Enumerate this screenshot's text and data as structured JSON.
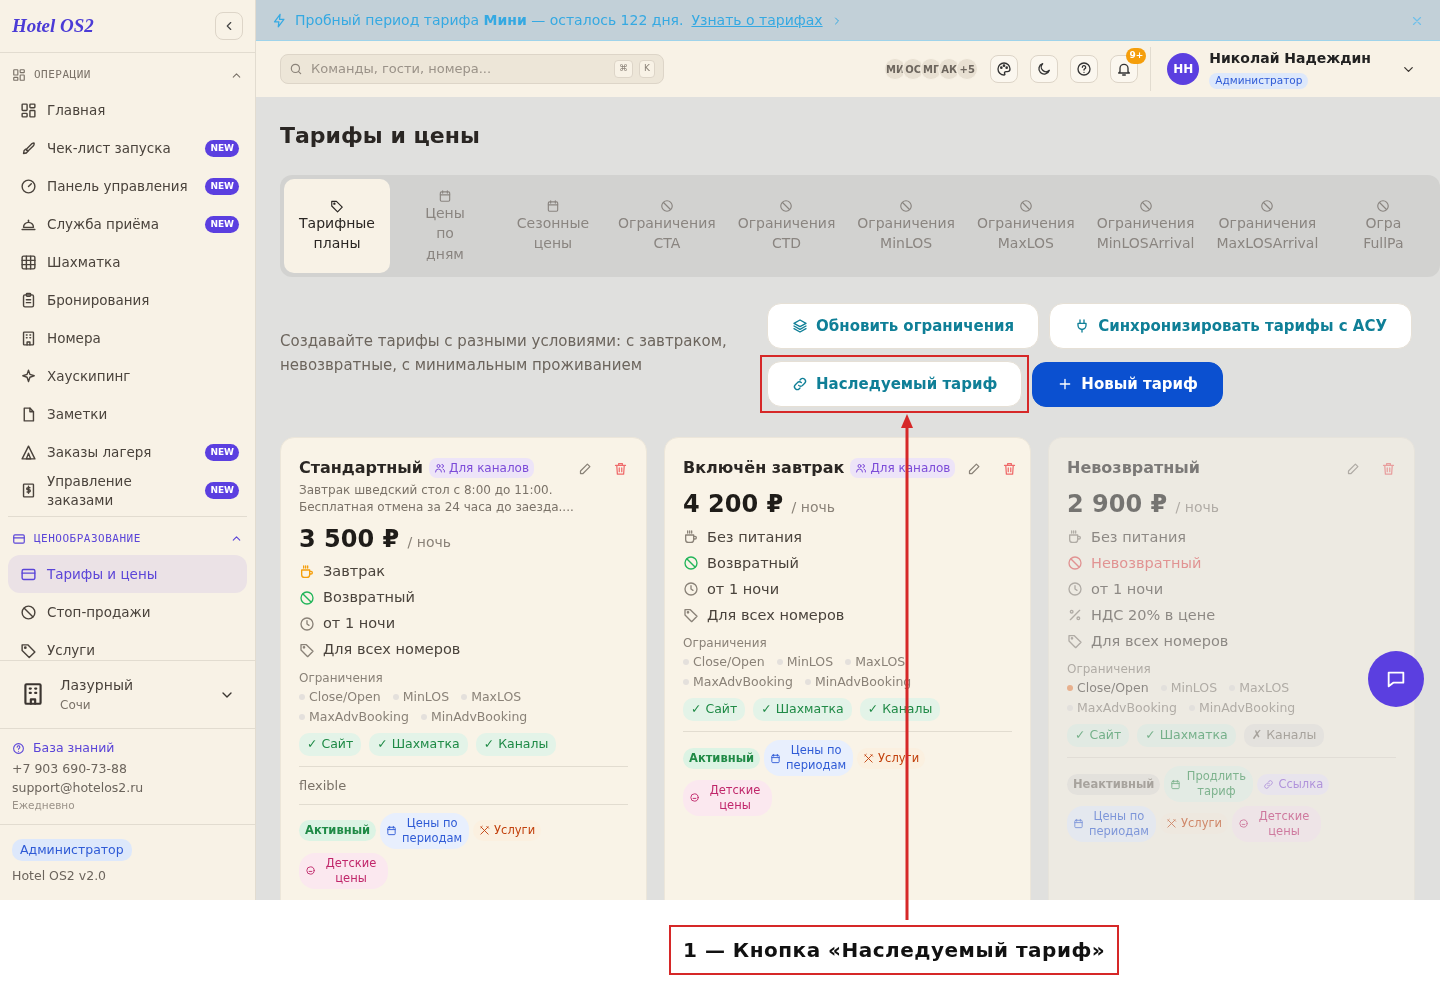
{
  "sidebar": {
    "logo": "Hotel OS2",
    "sections": [
      {
        "title": "ОПЕРАЦИИ",
        "expanded": true,
        "items": [
          {
            "label": "Главная",
            "selected": false
          },
          {
            "label": "Чек-лист запуска",
            "badge": "NEW",
            "selected": false
          },
          {
            "label": "Панель управления",
            "badge": "NEW",
            "selected": false
          },
          {
            "label": "Служба приёма",
            "badge": "NEW",
            "selected": false
          },
          {
            "label": "Шахматка",
            "selected": false
          },
          {
            "label": "Бронирования",
            "selected": false
          },
          {
            "label": "Номера",
            "selected": false
          },
          {
            "label": "Хаускипинг",
            "selected": false
          },
          {
            "label": "Заметки",
            "selected": false
          },
          {
            "label": "Заказы лагеря",
            "badge": "NEW",
            "selected": false
          },
          {
            "label": "Управление заказами",
            "badge": "NEW",
            "selected": false
          }
        ]
      },
      {
        "title": "ЦЕНООБРАЗОВАНИЕ",
        "expanded": true,
        "items": [
          {
            "label": "Тарифы и цены",
            "selected": true
          },
          {
            "label": "Стоп-продажи",
            "selected": false
          },
          {
            "label": "Услуги",
            "selected": false
          }
        ]
      }
    ],
    "property": {
      "name": "Лазурный",
      "city": "Сочи"
    },
    "help": {
      "link": "База знаний",
      "phone": "+7 903 690-73-88",
      "email": "support@hotelos2.ru",
      "hours": "Ежедневно"
    },
    "footer": {
      "role": "Администратор",
      "version": "Hotel OS2 v2.0"
    }
  },
  "banner": {
    "text": "Пробный период тарифа **Мини** — осталось 122 дня.",
    "link": "Узнать о тарифах"
  },
  "topbar": {
    "search": {
      "placeholder": "Команды, гости, номера..."
    },
    "shortcut": [
      "⌘",
      "K"
    ],
    "online_users": [
      "МИ",
      "ОС",
      "МГ",
      "АК"
    ],
    "more_users": "+5",
    "notifications": "9+",
    "user": {
      "initials": "НН",
      "name": "Николай Надеждин",
      "role": "Администратор"
    }
  },
  "page": {
    "title": "Тарифы и цены",
    "tabs": [
      {
        "kind": "plans",
        "lines": [
          "Тарифные",
          "планы"
        ],
        "selected": true
      },
      {
        "kind": "calendar",
        "lines": [
          "Цены",
          "по",
          "дням"
        ],
        "selected": false
      },
      {
        "kind": "calendar",
        "lines": [
          "Сезонные",
          "цены"
        ],
        "selected": false
      },
      {
        "kind": "restriction",
        "lines": [
          "Ограничения",
          "CTA"
        ],
        "selected": false
      },
      {
        "kind": "restriction",
        "lines": [
          "Ограничения",
          "CTD"
        ],
        "selected": false
      },
      {
        "kind": "restriction",
        "lines": [
          "Ограничения",
          "MinLOS"
        ],
        "selected": false
      },
      {
        "kind": "restriction",
        "lines": [
          "Ограничения",
          "MaxLOS"
        ],
        "selected": false
      },
      {
        "kind": "restriction",
        "lines": [
          "Ограничения",
          "MinLOSArrival"
        ],
        "selected": false
      },
      {
        "kind": "restriction",
        "lines": [
          "Ограничения",
          "MaxLOSArrival"
        ],
        "selected": false
      },
      {
        "kind": "restriction",
        "lines": [
          "Огра",
          "FullPa"
        ],
        "selected": false
      }
    ],
    "description": "Создавайте тарифы с разными условиями: с завтраком, невозвратные, с минимальным проживанием",
    "buttons": {
      "refresh": "Обновить ограничения",
      "sync": "Синхронизировать тарифы с АСУ",
      "inherited": "Наследуемый тариф",
      "new": "Новый тариф"
    }
  },
  "cards": [
    {
      "title": "Стандартный",
      "badge": "Для каналов",
      "description": "Завтрак шведский стол с 8:00 до 11:00. Бесплатная отмена за 24 часа до заезда....",
      "price": "3 500 ₽",
      "unit": "/ ночь",
      "active": true,
      "features": [
        {
          "kind": "meal",
          "label": "Завтрак",
          "included": true
        },
        {
          "kind": "refund",
          "label": "Возвратный",
          "refundable": true
        },
        {
          "kind": "stay",
          "label": "от 1 ночи"
        },
        {
          "kind": "rooms",
          "label": "Для всех номеров"
        }
      ],
      "restrictions_label": "Ограничения",
      "restrictions": [
        {
          "label": "Close/Open",
          "on": false
        },
        {
          "label": "MinLOS",
          "on": false
        },
        {
          "label": "MaxLOS",
          "on": false
        },
        {
          "label": "MaxAdvBooking",
          "on": false
        },
        {
          "label": "MinAdvBooking",
          "on": false
        }
      ],
      "channels": [
        {
          "label": "✓ Сайт",
          "enabled": true
        },
        {
          "label": "✓ Шахматка",
          "enabled": true
        },
        {
          "label": "✓ Каналы",
          "enabled": true
        }
      ],
      "note": "flexible",
      "chips": [
        {
          "kind": "status",
          "label": "Активный",
          "active": true
        },
        {
          "kind": "periods",
          "label": "Цены по периодам"
        },
        {
          "kind": "services",
          "label": "Услуги"
        },
        {
          "kind": "kids",
          "label": "Детские цены"
        }
      ]
    },
    {
      "title": "Включён завтрак",
      "badge": "Для каналов",
      "price": "4 200 ₽",
      "unit": "/ ночь",
      "active": true,
      "features": [
        {
          "kind": "meal",
          "label": "Без питания",
          "included": false
        },
        {
          "kind": "refund",
          "label": "Возвратный",
          "refundable": true
        },
        {
          "kind": "stay",
          "label": "от 1 ночи"
        },
        {
          "kind": "rooms",
          "label": "Для всех номеров"
        }
      ],
      "restrictions_label": "Ограничения",
      "restrictions": [
        {
          "label": "Close/Open",
          "on": false
        },
        {
          "label": "MinLOS",
          "on": false
        },
        {
          "label": "MaxLOS",
          "on": false
        },
        {
          "label": "MaxAdvBooking",
          "on": false
        },
        {
          "label": "MinAdvBooking",
          "on": false
        }
      ],
      "channels": [
        {
          "label": "✓ Сайт",
          "enabled": true
        },
        {
          "label": "✓ Шахматка",
          "enabled": true
        },
        {
          "label": "✓ Каналы",
          "enabled": true
        }
      ],
      "chips": [
        {
          "kind": "status",
          "label": "Активный",
          "active": true
        },
        {
          "kind": "periods",
          "label": "Цены по периодам"
        },
        {
          "kind": "services",
          "label": "Услуги"
        },
        {
          "kind": "kids",
          "label": "Детские цены"
        }
      ]
    },
    {
      "title": "Невозвратный",
      "price": "2 900 ₽",
      "unit": "/ ночь",
      "active": false,
      "features": [
        {
          "kind": "meal",
          "label": "Без питания",
          "included": false
        },
        {
          "kind": "refund",
          "label": "Невозвратный",
          "refundable": false
        },
        {
          "kind": "stay",
          "label": "от 1 ночи"
        },
        {
          "kind": "vat",
          "label": "НДС 20% в цене"
        },
        {
          "kind": "rooms",
          "label": "Для всех номеров"
        }
      ],
      "restrictions_label": "Ограничения",
      "restrictions": [
        {
          "label": "Close/Open",
          "on": true
        },
        {
          "label": "MinLOS",
          "on": false
        },
        {
          "label": "MaxLOS",
          "on": false
        },
        {
          "label": "MaxAdvBooking",
          "on": false
        },
        {
          "label": "MinAdvBooking",
          "on": false
        }
      ],
      "channels": [
        {
          "label": "✓ Сайт",
          "enabled": true
        },
        {
          "label": "✓ Шахматка",
          "enabled": true
        },
        {
          "label": "✗ Каналы",
          "enabled": false
        }
      ],
      "chips": [
        {
          "kind": "status",
          "label": "Неактивный",
          "active": false
        },
        {
          "kind": "extend",
          "label": "Продлить тариф"
        },
        {
          "kind": "link",
          "label": "Ссылка"
        },
        {
          "kind": "periods",
          "label": "Цены по периодам"
        },
        {
          "kind": "services",
          "label": "Услуги"
        },
        {
          "kind": "kids",
          "label": "Детские цены"
        }
      ]
    }
  ],
  "annotation": {
    "caption": "1 — Кнопка «Наследуемый тариф»"
  }
}
